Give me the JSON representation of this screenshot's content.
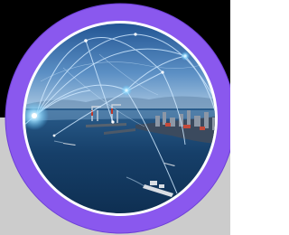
{
  "colors": {
    "ring": "#8a58ee",
    "ring_edge": "#6d3fd6",
    "inner_border": "#ffffff",
    "sky_top": "#1c4f8e",
    "sky_horizon": "#bcd4e8",
    "sea": "#123a63",
    "network_line": "#cfe9ff",
    "background_top": "#000000",
    "background_bottom": "#cccccc"
  },
  "image": {
    "subject": "harbor-network-photo",
    "icon": "circular-photo-badge"
  }
}
